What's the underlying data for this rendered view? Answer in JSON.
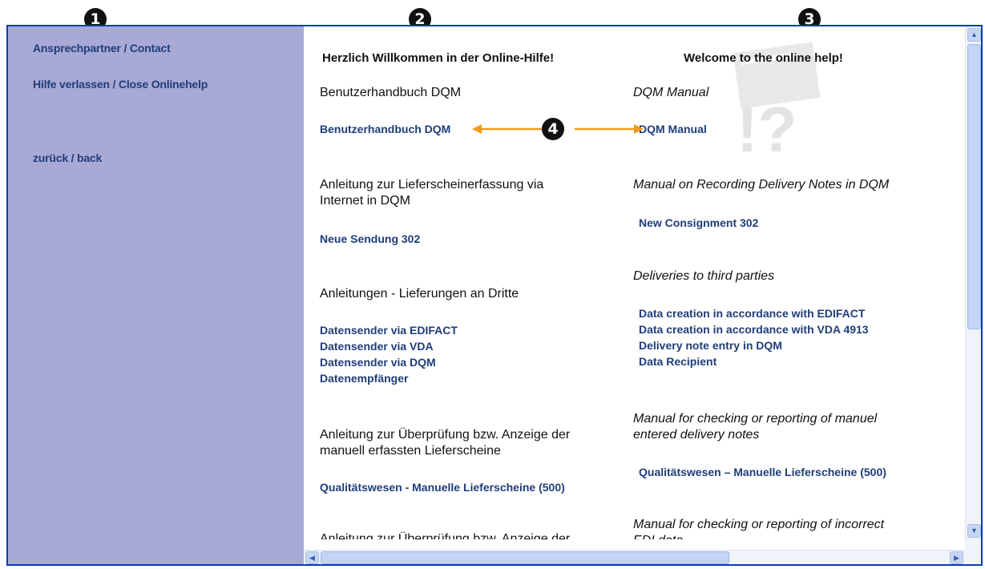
{
  "badges": {
    "b1": "1",
    "b2": "2",
    "b3": "3",
    "b4": "4"
  },
  "sidebar": {
    "contact": "Ansprechpartner / Contact",
    "close": "Hilfe verlassen / Close Onlinehelp",
    "back": "zurück / back"
  },
  "headings": {
    "de": "Herzlich Willkommen in der Online-Hilfe!",
    "en": "Welcome to the online help!"
  },
  "de": {
    "s1": "Benutzerhandbuch DQM",
    "l1": "Benutzerhandbuch DQM",
    "s2a": "Anleitung zur Lieferscheinerfassung via",
    "s2b": "Internet in DQM",
    "l2": "Neue Sendung 302",
    "s3": "Anleitungen - Lieferungen an Dritte",
    "l3a": "Datensender via EDIFACT",
    "l3b": "Datensender via VDA",
    "l3c": "Datensender via DQM",
    "l3d": "Datenempfänger",
    "s4a": "Anleitung zur Überprüfung bzw. Anzeige der",
    "s4b": "manuell erfassten Lieferscheine",
    "l4": "Qualitätswesen - Manuelle Lieferscheine (500)",
    "s5": "Anleitung zur Überprüfung bzw. Anzeige der"
  },
  "en": {
    "s1": "DQM Manual",
    "l1": "DQM Manual",
    "s2": "Manual on Recording Delivery Notes in DQM",
    "l2": "New Consignment 302",
    "s3": "Deliveries to third parties",
    "l3a": "Data creation in accordance with EDIFACT",
    "l3b": "Data creation in accordance with VDA 4913",
    "l3c": "Delivery note entry in DQM",
    "l3d": "Data Recipient",
    "s4a": "Manual for checking or reporting of manuel",
    "s4b": "entered delivery notes",
    "l4": "Qualitätswesen – Manuelle Lieferscheine (500)",
    "s5a": "Manual for checking or reporting of incorrect",
    "s5b": "EDI data"
  },
  "colors": {
    "sidebar": "#a9a9d6",
    "link": "#1f3d7a",
    "frame": "#0b3ea8",
    "arrow": "#f39a1e"
  },
  "icons": {
    "scroll_up": "arrow-up-icon",
    "scroll_down": "arrow-down-icon",
    "scroll_left": "arrow-left-icon",
    "scroll_right": "arrow-right-icon"
  }
}
